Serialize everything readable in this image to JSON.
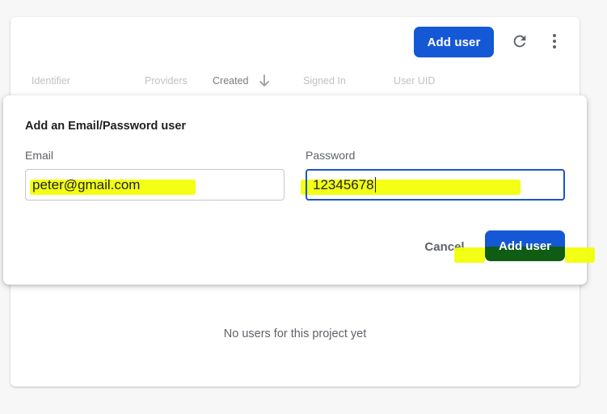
{
  "toolbar": {
    "add_user_label": "Add user",
    "refresh_icon": "refresh-icon",
    "more_icon": "more-vert-icon"
  },
  "table": {
    "columns": [
      "Identifier",
      "Providers",
      "Created",
      "Signed In",
      "User UID"
    ],
    "sorted_column": "Created",
    "sort_direction": "descending",
    "empty_message": "No users for this project yet"
  },
  "dialog": {
    "title": "Add an Email/Password user",
    "email_label": "Email",
    "email_value": "peter@gmail.com",
    "password_label": "Password",
    "password_value": "12345678",
    "cancel_label": "Cancel",
    "submit_label": "Add user"
  },
  "colors": {
    "primary": "#1558d6",
    "highlight": "#f2ff00",
    "focus_border": "#1a56c4"
  }
}
